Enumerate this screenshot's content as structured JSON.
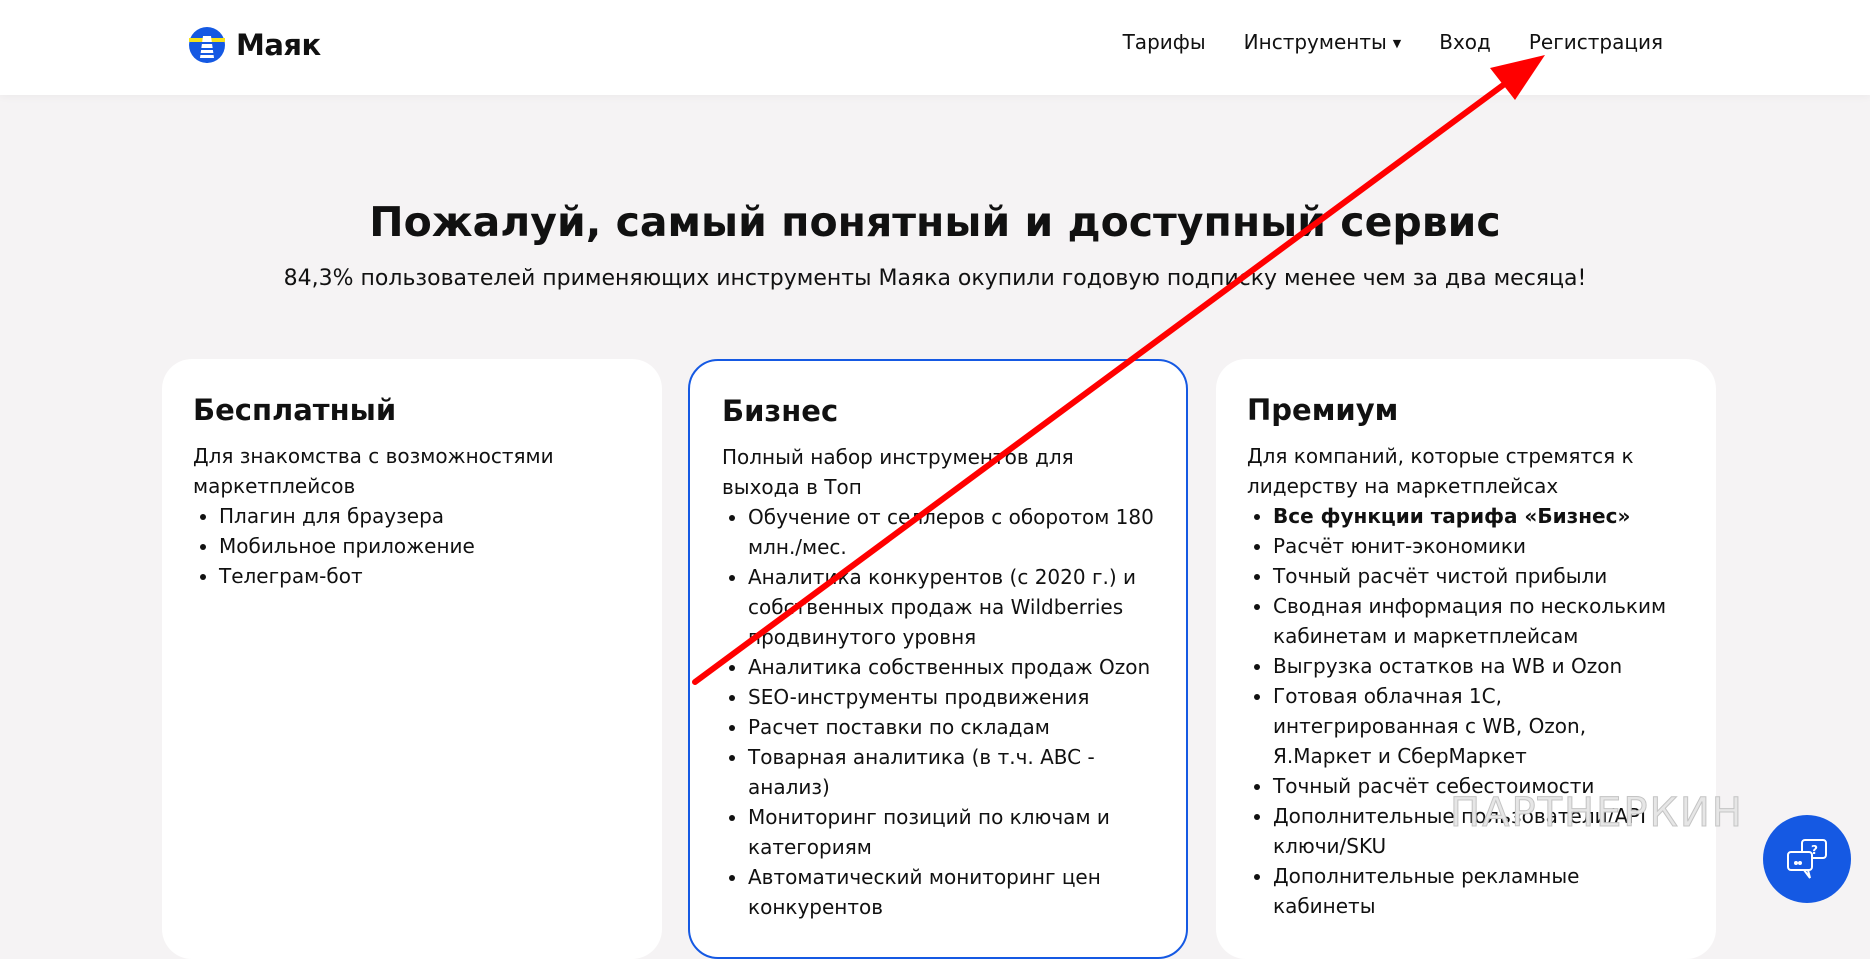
{
  "header": {
    "logo": "Маяк",
    "nav": [
      "Тарифы",
      "Инструменты",
      "Вход",
      "Регистрация"
    ]
  },
  "hero": {
    "title": "Пожалуй, самый понятный и доступный сервис",
    "subtitle": "84,3% пользователей применяющих инструменты Маяка окупили годовую подписку менее чем за два месяца!"
  },
  "plans": [
    {
      "name": "Бесплатный",
      "desc": "Для знакомства с возможностями маркетплейсов",
      "features": [
        "Плагин для браузера",
        "Мобильное приложение",
        "Телеграм-бот"
      ]
    },
    {
      "name": "Бизнес",
      "desc": "Полный набор инструментов для выхода в Топ",
      "features": [
        "Обучение от селлеров с оборотом 180 млн./мес.",
        "Аналитика конкурентов (с 2020 г.) и собственных продаж на Wildberries продвинутого уровня",
        "Аналитика собственных продаж Ozon",
        "SEO-инструменты продвижения",
        "Расчет поставки по складам",
        "Товарная аналитика (в т.ч. ABC - анализ)",
        "Мониторинг позиций по ключам и категориям",
        "Автоматический мониторинг цен конкурентов"
      ]
    },
    {
      "name": "Премиум",
      "desc": "Для компаний, которые стремятся к лидерству на маркетплейсах",
      "features": [
        "Все функции тарифа «Бизнес»",
        "Расчёт юнит-экономики",
        "Точный расчёт чистой прибыли",
        "Сводная информация по нескольким кабинетам и маркетплейсам",
        "Выгрузка остатков на WB и Ozon",
        "Готовая облачная 1С, интегрированная с WB, Ozon, Я.Маркет и СберМаркет",
        "Точный расчёт себестоимости",
        "Дополнительные пользователи/API ключи/SKU",
        "Дополнительные рекламные кабинеты"
      ]
    }
  ],
  "watermark": "ПАРТНЕРКИН",
  "colors": {
    "accent": "#1559e3",
    "arrow": "#ff0000"
  }
}
